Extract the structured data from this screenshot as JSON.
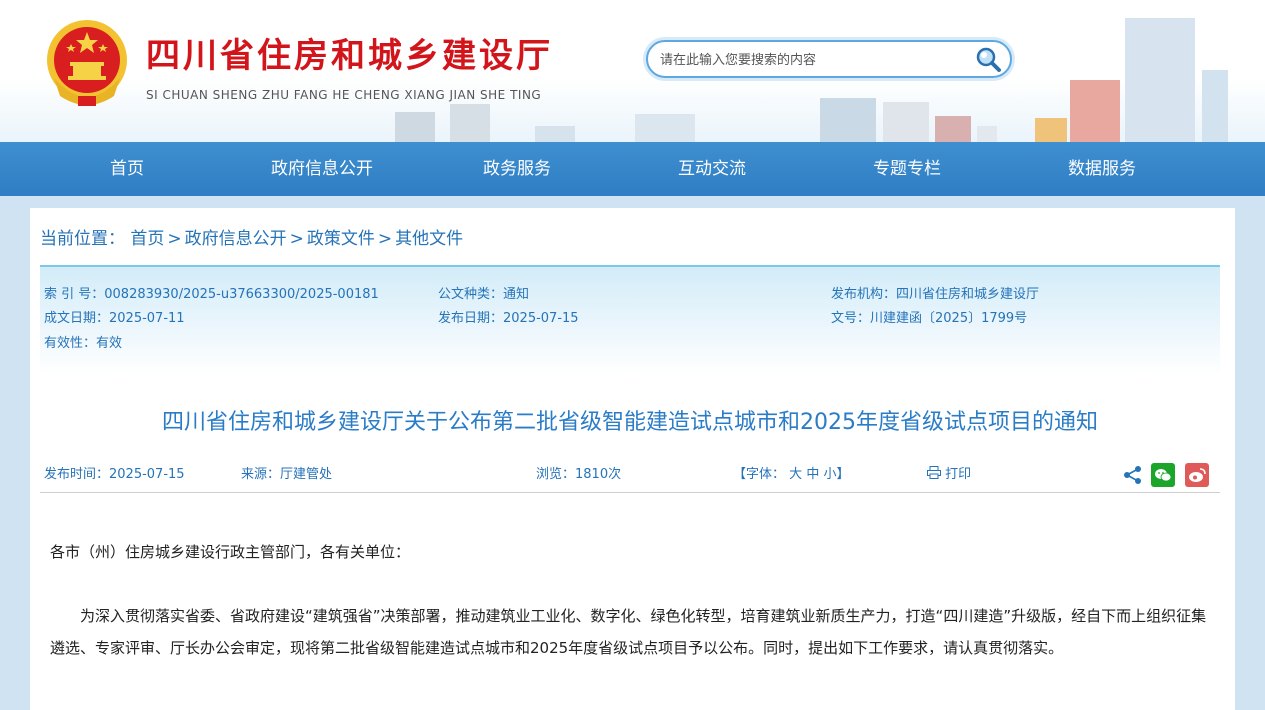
{
  "header": {
    "title": "四川省住房和城乡建设厅",
    "subtitle": "SI CHUAN SHENG ZHU FANG HE CHENG XIANG JIAN SHE TING",
    "search_placeholder": "请在此输入您要搜索的内容"
  },
  "nav": {
    "items": [
      "首页",
      "政府信息公开",
      "政务服务",
      "互动交流",
      "专题专栏",
      "数据服务"
    ]
  },
  "breadcrumb": {
    "label": "当前位置：",
    "items": [
      "首页",
      "政府信息公开",
      "政策文件",
      "其他文件"
    ],
    "separator": ">"
  },
  "meta": {
    "index_label": "索 引 号：",
    "index_value": "008283930/2025-u37663300/2025-00181",
    "category_label": "公文种类：",
    "category_value": "通知",
    "agency_label": "发布机构：",
    "agency_value": "四川省住房和城乡建设厅",
    "created_label": "成文日期：",
    "created_value": "2025-07-11",
    "published_label": "发布日期：",
    "published_value": "2025-07-15",
    "docno_label": "文号：",
    "docno_value": "川建建函〔2025〕1799号",
    "validity_label": "有效性：",
    "validity_value": "有效"
  },
  "article": {
    "title": "四川省住房和城乡建设厅关于公布第二批省级智能建造试点城市和2025年度省级试点项目的通知",
    "publish_time_label": "发布时间：",
    "publish_time": "2025-07-15",
    "source_label": "来源：",
    "source": "厅建管处",
    "views_label": "浏览：",
    "views": "1810次",
    "font_label": "【字体：",
    "font_large": "大",
    "font_medium": "中",
    "font_small": "小",
    "font_close": "】",
    "print_label": "打印",
    "paragraphs": [
      "各市（州）住房城乡建设行政主管部门，各有关单位：",
      "为深入贯彻落实省委、省政府建设“建筑强省”决策部署，推动建筑业工业化、数字化、绿色化转型，培育建筑业新质生产力，打造“四川建造”升级版，经自下而上组织征集遴选、专家评审、厅长办公会审定，现将第二批省级智能建造试点城市和2025年度省级试点项目予以公布。同时，提出如下工作要求，请认真贯彻落实。"
    ]
  },
  "colors": {
    "brand_red": "#d2151a",
    "nav_blue": "#2f7dc4",
    "link_blue": "#2573b8",
    "title_blue": "#2a7cc7"
  },
  "icons": [
    "emblem-icon",
    "search-icon",
    "print-icon",
    "share-icon",
    "wechat-icon",
    "weibo-icon"
  ]
}
